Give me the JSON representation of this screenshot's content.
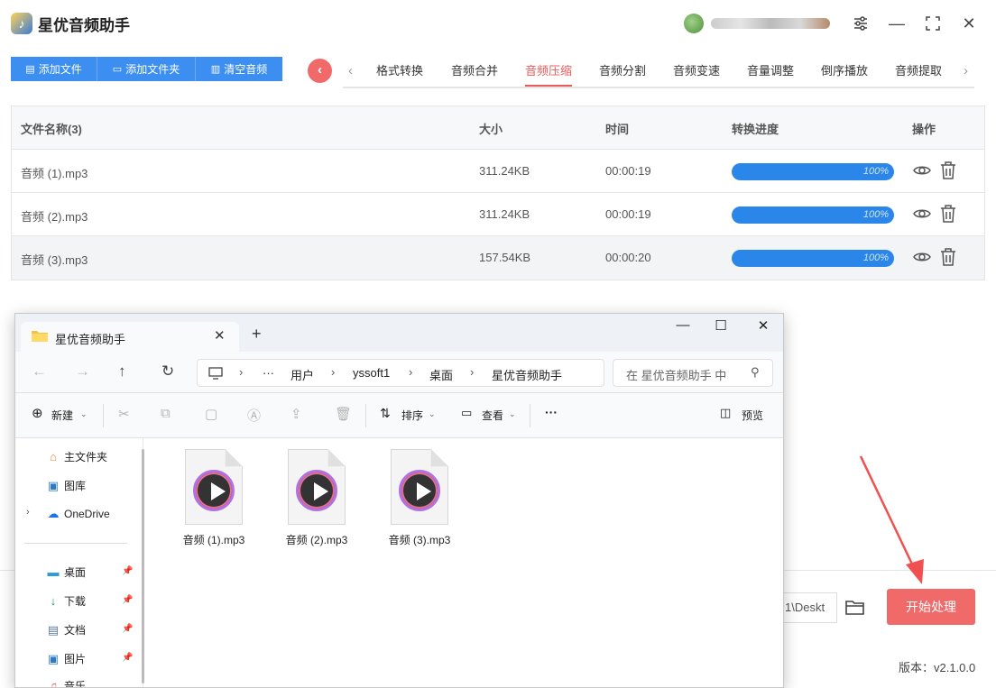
{
  "app": {
    "title": "星优音频助手",
    "logo_glyph": "♪"
  },
  "window_controls": {
    "settings": "⚙",
    "minimize": "—",
    "maximize": "⛶",
    "close": "✕"
  },
  "toolbar": {
    "add_file": "添加文件",
    "add_folder": "添加文件夹",
    "clear_audio": "清空音频"
  },
  "tabs": {
    "items": [
      "格式转换",
      "音频合并",
      "音频压缩",
      "音频分割",
      "音频变速",
      "音量调整",
      "倒序播放",
      "音频提取"
    ],
    "active": "音频压缩"
  },
  "table": {
    "headers": {
      "name": "文件名称(3)",
      "size": "大小",
      "time": "时间",
      "progress": "转换进度",
      "action": "操作"
    },
    "rows": [
      {
        "name": "音频 (1).mp3",
        "size": "311.24KB",
        "time": "00:00:19",
        "progress": "100%",
        "progress_value": 1.0
      },
      {
        "name": "音频 (2).mp3",
        "size": "311.24KB",
        "time": "00:00:19",
        "progress": "100%",
        "progress_value": 1.0
      },
      {
        "name": "音频 (3).mp3",
        "size": "157.54KB",
        "time": "00:00:20",
        "progress": "100%",
        "progress_value": 1.0
      }
    ]
  },
  "bottom": {
    "output_path": "1\\Deskt",
    "start_button": "开始处理",
    "version": "版本：v2.1.0.0"
  },
  "explorer": {
    "tab_title": "星优音频助手",
    "breadcrumb": [
      "用户",
      "yssoft1",
      "桌面",
      "星优音频助手"
    ],
    "search_placeholder": "在 星优音频助手 中",
    "commands": {
      "new": "新建",
      "sort": "排序",
      "view": "查看",
      "more": "···",
      "preview": "预览"
    },
    "sidebar": {
      "top": [
        {
          "label": "主文件夹",
          "icon": "home-icon"
        },
        {
          "label": "图库",
          "icon": "gallery-icon"
        },
        {
          "label": "OneDrive",
          "icon": "cloud-icon"
        }
      ],
      "pinned": [
        {
          "label": "桌面",
          "icon": "desktop-icon"
        },
        {
          "label": "下载",
          "icon": "download-icon"
        },
        {
          "label": "文档",
          "icon": "document-icon"
        },
        {
          "label": "图片",
          "icon": "picture-icon"
        },
        {
          "label": "音乐",
          "icon": "music-icon"
        }
      ]
    },
    "files": [
      "音频 (1).mp3",
      "音频 (2).mp3",
      "音频 (3).mp3"
    ]
  },
  "colors": {
    "accent_blue": "#3c8ff0",
    "accent_red": "#f06a6a",
    "progress_blue": "#2b86ea"
  }
}
